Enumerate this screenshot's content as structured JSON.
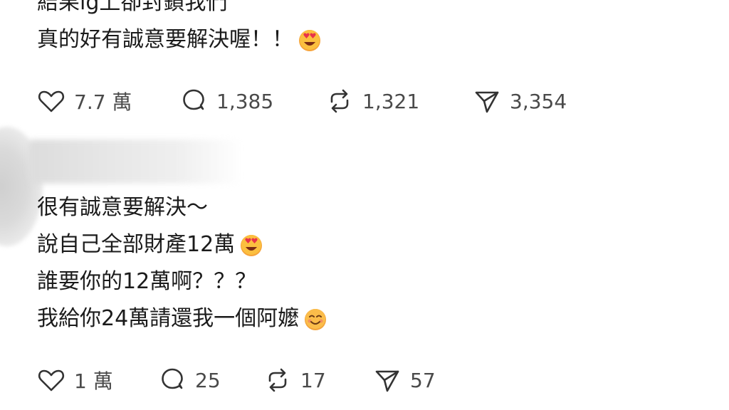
{
  "post1": {
    "lines": [
      "結果ig上卻封鎖我們",
      "真的好有誠意要解決喔！！"
    ],
    "emoji_line2": "heart-eyes-emoji",
    "actions": {
      "like_count": "7.7 萬",
      "comment_count": "1,385",
      "repost_count": "1,321",
      "share_count": "3,354"
    }
  },
  "post2": {
    "lines": [
      "很有誠意要解決～",
      "說自己全部財產12萬",
      "誰要你的12萬啊？？？",
      "我給你24萬請還我一個阿嬤"
    ],
    "emoji_line2": "heart-eyes-emoji",
    "emoji_line4": "smiling-emoji",
    "actions": {
      "like_count": "1 萬",
      "comment_count": "25",
      "repost_count": "17",
      "share_count": "57"
    }
  },
  "icons": [
    "heart-icon",
    "comment-icon",
    "repost-icon",
    "send-icon"
  ]
}
